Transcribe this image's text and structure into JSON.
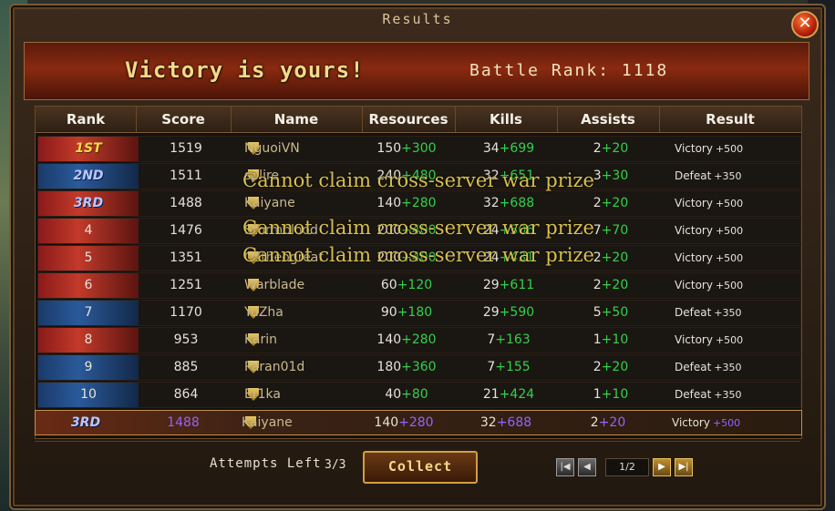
{
  "window": {
    "title": "Results",
    "close_glyph": "✕"
  },
  "banner": {
    "headline": "Victory is yours!",
    "battle_rank": "Battle Rank: 1118"
  },
  "table": {
    "headers": [
      "Rank",
      "Score",
      "Name",
      "Resources",
      "Kills",
      "Assists",
      "Result"
    ],
    "rows": [
      {
        "rank": "1ST",
        "score": "1519",
        "name": "NguoiVN",
        "res_base": "150",
        "res_bonus": "+300",
        "kills_base": "34",
        "kills_bonus": "+699",
        "assists_base": "2",
        "assists_bonus": "+20",
        "result": "Victory",
        "result_bonus": "+500"
      },
      {
        "rank": "2ND",
        "score": "1511",
        "name": "splire",
        "res_base": "240",
        "res_bonus": "+480",
        "kills_base": "32",
        "kills_bonus": "+651",
        "assists_base": "3",
        "assists_bonus": "+30",
        "result": "Defeat",
        "result_bonus": "+350"
      },
      {
        "rank": "3RD",
        "score": "1488",
        "name": "Kaiyane",
        "res_base": "140",
        "res_bonus": "+280",
        "kills_base": "32",
        "kills_bonus": "+688",
        "assists_base": "2",
        "assists_bonus": "+20",
        "result": "Victory",
        "result_bonus": "+500"
      },
      {
        "rank": "4",
        "score": "1476",
        "name": "Stormblood",
        "res_base": "200",
        "res_bonus": "+400",
        "kills_base": "24",
        "kills_bonus": "+506",
        "assists_base": "7",
        "assists_bonus": "+70",
        "result": "Victory",
        "result_bonus": "+500"
      },
      {
        "rank": "5",
        "score": "1351",
        "name": "Ostheogreat",
        "res_base": "200",
        "res_bonus": "+400",
        "kills_base": "24",
        "kills_bonus": "+431",
        "assists_base": "2",
        "assists_bonus": "+20",
        "result": "Victory",
        "result_bonus": "+500"
      },
      {
        "rank": "6",
        "score": "1251",
        "name": "Warblade",
        "res_base": "60",
        "res_bonus": "+120",
        "kills_base": "29",
        "kills_bonus": "+611",
        "assists_base": "2",
        "assists_bonus": "+20",
        "result": "Victory",
        "result_bonus": "+500"
      },
      {
        "rank": "7",
        "score": "1170",
        "name": "YuZha",
        "res_base": "90",
        "res_bonus": "+180",
        "kills_base": "29",
        "kills_bonus": "+590",
        "assists_base": "5",
        "assists_bonus": "+50",
        "result": "Defeat",
        "result_bonus": "+350"
      },
      {
        "rank": "8",
        "score": "953",
        "name": "Karin",
        "res_base": "140",
        "res_bonus": "+280",
        "kills_base": "7",
        "kills_bonus": "+163",
        "assists_base": "1",
        "assists_bonus": "+10",
        "result": "Victory",
        "result_bonus": "+500"
      },
      {
        "rank": "9",
        "score": "885",
        "name": "Paran01d",
        "res_base": "180",
        "res_bonus": "+360",
        "kills_base": "7",
        "kills_bonus": "+155",
        "assists_base": "2",
        "assists_bonus": "+20",
        "result": "Defeat",
        "result_bonus": "+350"
      },
      {
        "rank": "10",
        "score": "864",
        "name": "Er1ka",
        "res_base": "40",
        "res_bonus": "+80",
        "kills_base": "21",
        "kills_bonus": "+424",
        "assists_base": "1",
        "assists_bonus": "+10",
        "result": "Defeat",
        "result_bonus": "+350"
      }
    ],
    "own_row": {
      "rank": "3RD",
      "score": "1488",
      "name": "Kaiyane",
      "res_base": "140",
      "res_bonus": "+280",
      "kills_base": "32",
      "kills_bonus": "+688",
      "assists_base": "2",
      "assists_bonus": "+20",
      "result": "Victory",
      "result_bonus": "+500"
    }
  },
  "overlay_messages": [
    "Cannot claim cross-server war prize",
    "Cannot claim cross-server war prize",
    "Cannot claim cross-server war prize"
  ],
  "footer": {
    "attempts_label": "Attempts Left",
    "attempts_value": "3/3",
    "collect_label": "Collect",
    "page_indicator": "1/2",
    "first_glyph": "|◀",
    "prev_glyph": "◀",
    "next_glyph": "▶",
    "last_glyph": "▶|"
  },
  "colors": {
    "bonus_green": "#34d04a",
    "own_purple": "#9a60ff",
    "rank_gold": "#ffd84a",
    "victory_text": "#f5d98a"
  },
  "row_styles": [
    "red",
    "blue",
    "red",
    "red",
    "red",
    "red",
    "blue",
    "red",
    "blue",
    "blue"
  ]
}
